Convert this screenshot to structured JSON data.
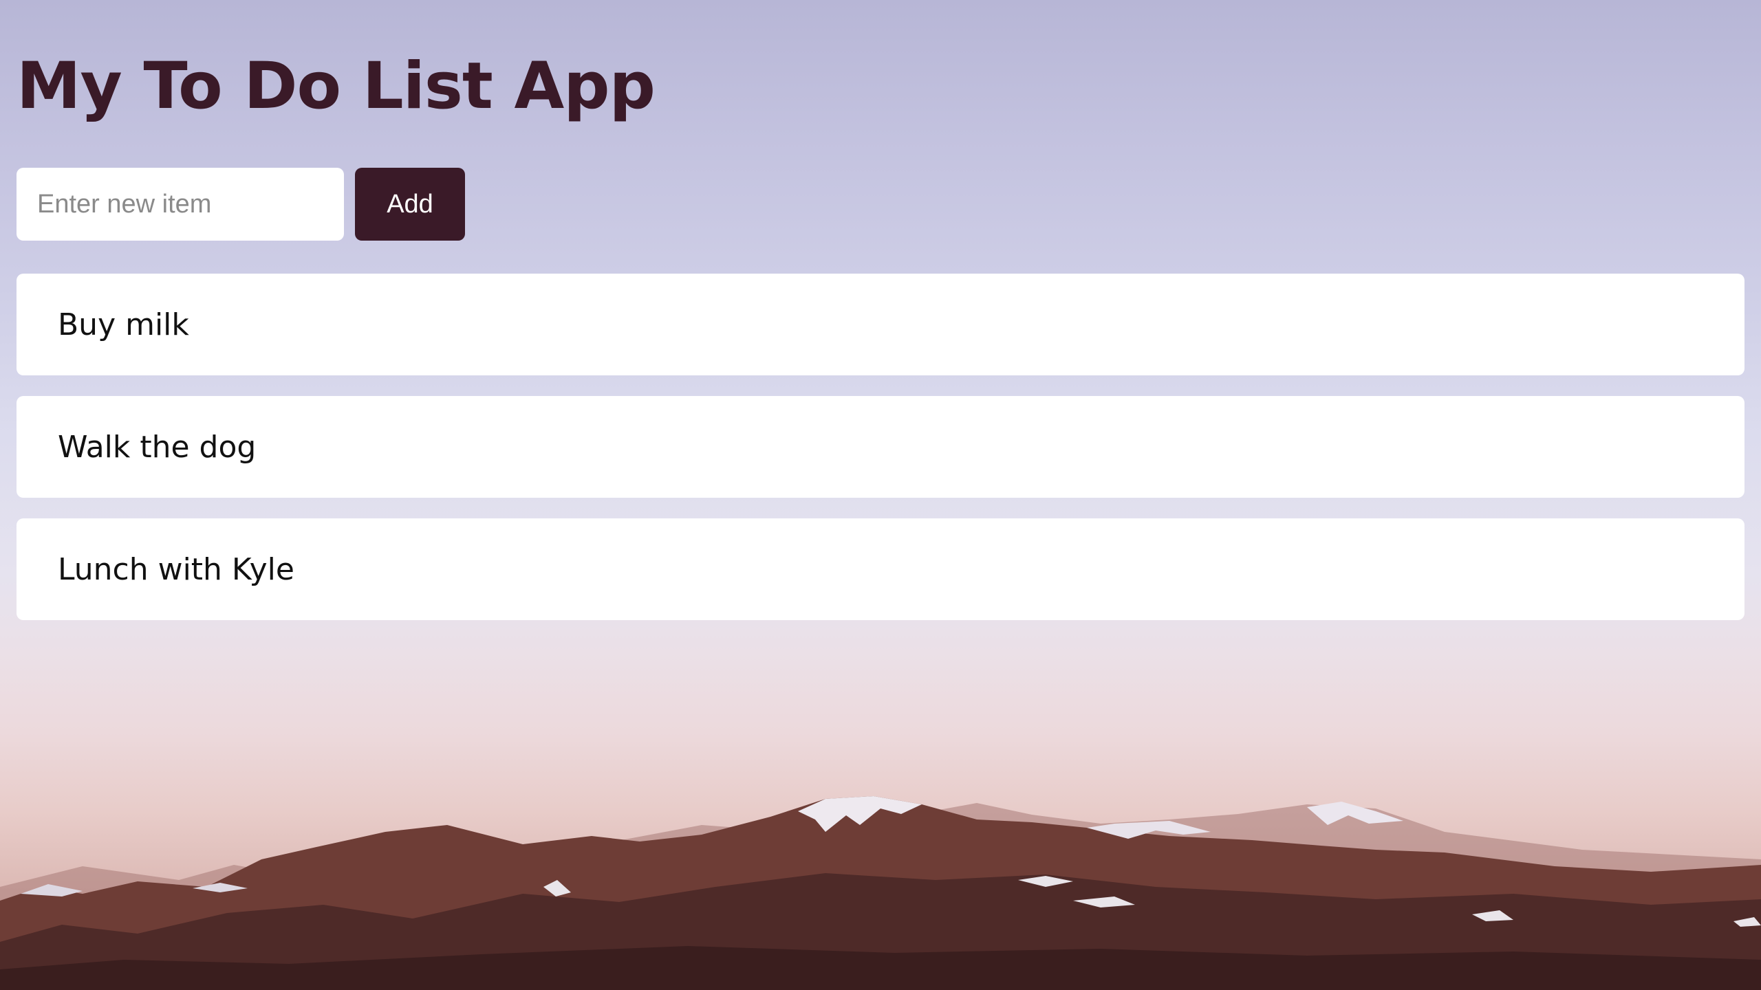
{
  "app": {
    "title": "My To Do List App"
  },
  "form": {
    "input_value": "",
    "input_placeholder": "Enter new item",
    "add_label": "Add"
  },
  "todos": [
    {
      "text": "Buy milk"
    },
    {
      "text": "Walk the dog"
    },
    {
      "text": "Lunch with Kyle"
    }
  ],
  "colors": {
    "accent": "#3a1a28",
    "card": "#ffffff",
    "sky_top": "#b7b6d6",
    "sky_horizon": "#ecd9dc"
  }
}
